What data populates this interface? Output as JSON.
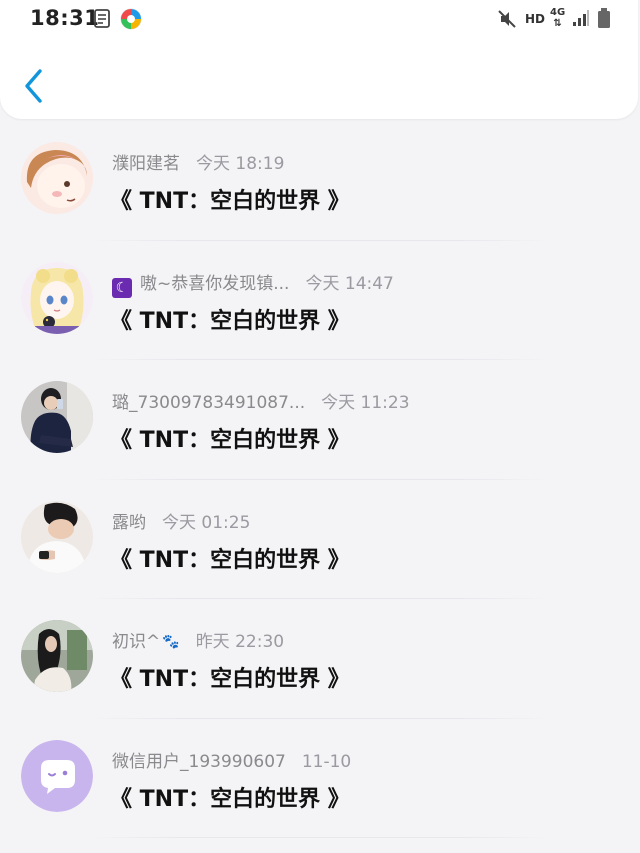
{
  "status_bar": {
    "time": "18:31",
    "hd_label": "HD",
    "network_label": "4G"
  },
  "comments": [
    {
      "name": "濮阳建茗",
      "time": "今天 18:19",
      "text": "《 TNT：空白的世界 》"
    },
    {
      "name": "嗷~恭喜你发现镇...",
      "time": "今天 14:47",
      "text": "《 TNT：空白的世界 》"
    },
    {
      "name": "璐_73009783491087...",
      "time": "今天 11:23",
      "text": "《 TNT：空白的世界 》"
    },
    {
      "name": "露哟",
      "time": "今天 01:25",
      "text": "《 TNT：空白的世界 》"
    },
    {
      "name": "初识^",
      "time": "昨天 22:30",
      "text": "《 TNT：空白的世界 》"
    },
    {
      "name": "微信用户_193990607",
      "time": "11-10",
      "text": "《 TNT：空白的世界 》"
    }
  ],
  "colors": {
    "accent": "#1296db",
    "background": "#f4f4f6",
    "name_gray": "#8a8a8e",
    "default_avatar": "#c9b5ee"
  }
}
